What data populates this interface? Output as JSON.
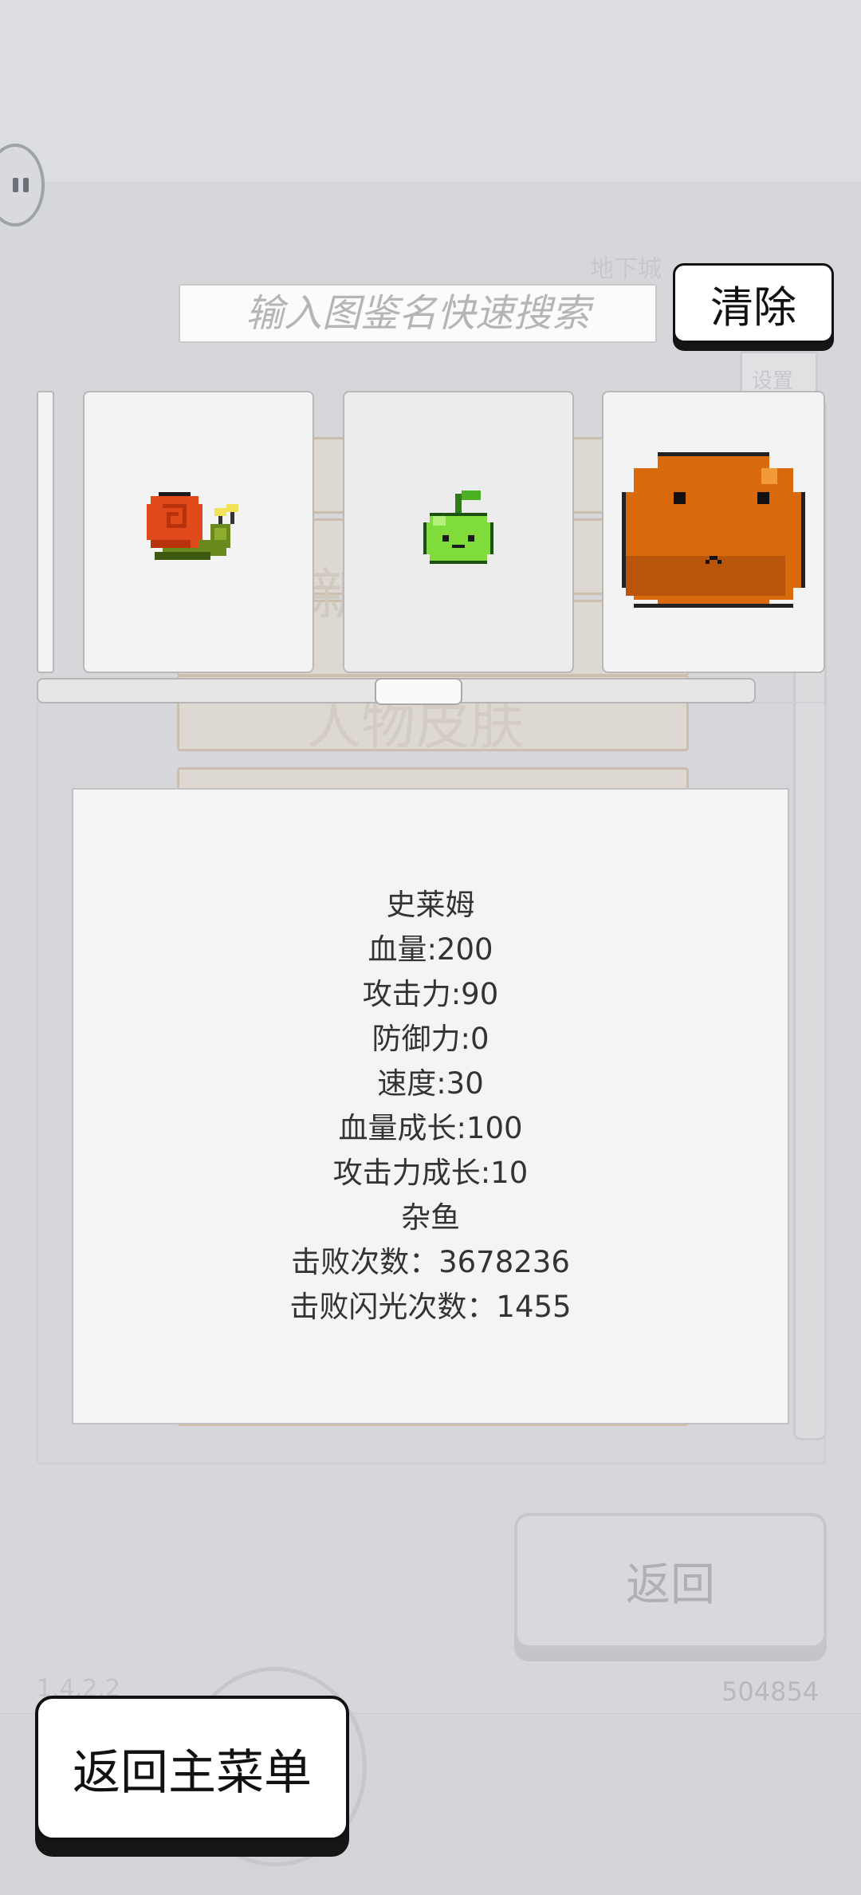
{
  "background": {
    "top_label": "地下城",
    "settings_label": "设置",
    "mid_text_1": "新",
    "mid_text_2": "人物皮肤"
  },
  "search": {
    "placeholder": "输入图鉴名快速搜索",
    "value": ""
  },
  "clear_button": {
    "label": "清除"
  },
  "cards": [
    {
      "name": "snail",
      "icon": "snail-icon"
    },
    {
      "name": "green-apple-slime",
      "icon": "green-apple-icon"
    },
    {
      "name": "orange-slime",
      "icon": "orange-slime-icon"
    }
  ],
  "info": {
    "name": "史莱姆",
    "hp": "血量:200",
    "attack": "攻击力:90",
    "defense": "防御力:0",
    "speed": "速度:30",
    "hp_growth": "血量成长:100",
    "attack_growth": "攻击力成长:10",
    "category": "杂鱼",
    "defeat_count": "击败次数：3678236",
    "flash_defeat_count": "击败闪光次数：1455"
  },
  "return_button": {
    "label": "返回"
  },
  "score": "504854",
  "version": "1.4.2.2",
  "main_menu_button": {
    "label": "返回主菜单"
  },
  "colors": {
    "snail_shell": "#e04a1a",
    "apple_green": "#7fdc3a",
    "orange_slime": "#d96a0c"
  }
}
